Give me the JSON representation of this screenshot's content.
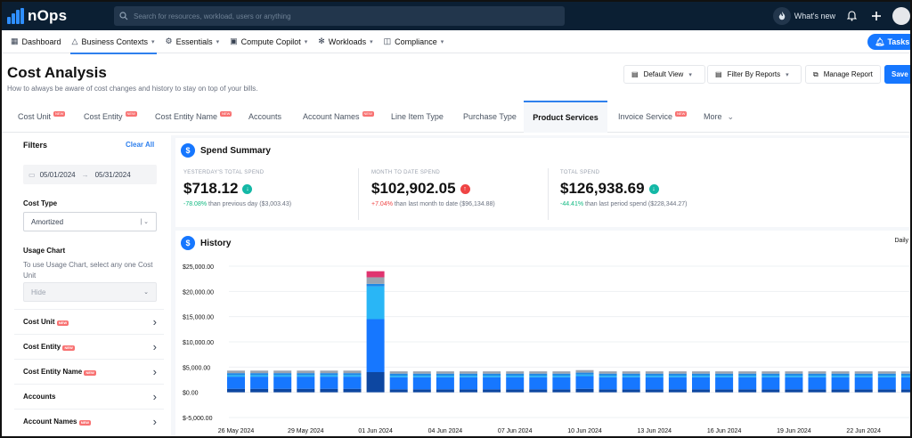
{
  "app": {
    "logo_text": "nOps"
  },
  "search": {
    "placeholder": "Search for resources, workload, users or anything"
  },
  "topbar": {
    "whats_new": "What's new"
  },
  "nav": {
    "items": [
      {
        "label": "Dashboard",
        "icon": "grid-icon"
      },
      {
        "label": "Business Contexts",
        "icon": "triangle-icon"
      },
      {
        "label": "Essentials",
        "icon": "gear-icon"
      },
      {
        "label": "Compute Copilot",
        "icon": "chip-icon"
      },
      {
        "label": "Workloads",
        "icon": "cog-icon"
      },
      {
        "label": "Compliance",
        "icon": "shield-icon"
      }
    ],
    "tasks_label": "Tasks"
  },
  "header": {
    "title": "Cost Analysis",
    "subtitle": "How to always be aware of cost changes and history to stay on top of your bills.",
    "default_view": "Default View",
    "filter_reports": "Filter By Reports",
    "manage_report": "Manage Report",
    "save": "Save I"
  },
  "tabs": [
    {
      "label": "Cost Unit",
      "badge": "NEW"
    },
    {
      "label": "Cost Entity",
      "badge": "NEW"
    },
    {
      "label": "Cost Entity Name",
      "badge": "NEW"
    },
    {
      "label": "Accounts",
      "badge": ""
    },
    {
      "label": "Account Names",
      "badge": "NEW"
    },
    {
      "label": "Line Item Type",
      "badge": ""
    },
    {
      "label": "Purchase Type",
      "badge": ""
    },
    {
      "label": "Product Services",
      "badge": "",
      "active": true
    },
    {
      "label": "Invoice Service",
      "badge": "NEW"
    },
    {
      "label": "More",
      "badge": ""
    }
  ],
  "sidebar": {
    "filters": "Filters",
    "clear_all": "Clear All",
    "date_start": "05/01/2024",
    "date_sep": "→",
    "date_end": "05/31/2024",
    "cost_type_label": "Cost Type",
    "cost_type_value": "Amortized",
    "usage_chart_label": "Usage Chart",
    "usage_chart_help": "To use Usage Chart, select any one Cost Unit",
    "usage_chart_value": "Hide",
    "rows": [
      {
        "label": "Cost Unit",
        "badge": "NEW"
      },
      {
        "label": "Cost Entity",
        "badge": "NEW"
      },
      {
        "label": "Cost Entity Name",
        "badge": "NEW"
      },
      {
        "label": "Accounts",
        "badge": ""
      },
      {
        "label": "Account Names",
        "badge": "NEW"
      }
    ]
  },
  "summary": {
    "title": "Spend Summary",
    "stats": [
      {
        "label": "YESTERDAY'S TOTAL SPEND",
        "value": "$718.12",
        "trend": "down",
        "pct": "-78.08%",
        "detail": "than previous day ($3,003.43)"
      },
      {
        "label": "MONTH TO DATE SPEND",
        "value": "$102,902.05",
        "trend": "up",
        "pct": "+7.04%",
        "detail": "than last month to date ($96,134.88)"
      },
      {
        "label": "TOTAL SPEND",
        "value": "$126,938.69",
        "trend": "down",
        "pct": "-44.41%",
        "detail": "than last period spend ($228,344.27)"
      }
    ]
  },
  "history": {
    "title": "History",
    "granularity": "Daily"
  },
  "colors": {
    "accent": "#1677ff",
    "seg_base": "#1677ff",
    "seg_mid": "#1e88e5",
    "seg_light": "#29b6f6",
    "seg_gray": "#9ca3af",
    "seg_pink": "#e0336f",
    "seg_dark": "#0d47a1"
  },
  "chart_data": {
    "type": "bar",
    "stacked": true,
    "title": "",
    "xlabel": "",
    "ylabel": "",
    "ylim": [
      -5000,
      25000
    ],
    "yticks": [
      -5000,
      0,
      5000,
      10000,
      15000,
      20000,
      25000
    ],
    "ytick_labels": [
      "$-5,000.00",
      "$0.00",
      "$5,000.00",
      "$10,000.00",
      "$15,000.00",
      "$20,000.00",
      "$25,000.00"
    ],
    "categories": [
      "26 May 2024",
      "27 May 2024",
      "28 May 2024",
      "29 May 2024",
      "30 May 2024",
      "31 May 2024",
      "01 Jun 2024",
      "02 Jun 2024",
      "03 Jun 2024",
      "04 Jun 2024",
      "05 Jun 2024",
      "06 Jun 2024",
      "07 Jun 2024",
      "08 Jun 2024",
      "09 Jun 2024",
      "10 Jun 2024",
      "11 Jun 2024",
      "12 Jun 2024",
      "13 Jun 2024",
      "14 Jun 2024",
      "15 Jun 2024",
      "16 Jun 2024",
      "17 Jun 2024",
      "18 Jun 2024",
      "19 Jun 2024",
      "20 Jun 2024",
      "21 Jun 2024",
      "22 Jun 2024",
      "23 Jun 2024",
      "24 Jun 2024",
      "25 Jun 2024"
    ],
    "xtick_labels": [
      "26 May 2024",
      "29 May 2024",
      "01 Jun 2024",
      "04 Jun 2024",
      "07 Jun 2024",
      "10 Jun 2024",
      "13 Jun 2024",
      "16 Jun 2024",
      "19 Jun 2024",
      "22 Jun 2024"
    ],
    "series": [
      {
        "values": [
          700,
          700,
          700,
          700,
          700,
          700,
          4000,
          600,
          600,
          600,
          600,
          600,
          600,
          600,
          600,
          700,
          600,
          600,
          600,
          600,
          600,
          600,
          600,
          600,
          600,
          600,
          600,
          600,
          600,
          600,
          0
        ]
      },
      {
        "values": [
          2400,
          2400,
          2400,
          2400,
          2400,
          2400,
          10500,
          2400,
          2400,
          2400,
          2400,
          2400,
          2400,
          2400,
          2400,
          2500,
          2400,
          2400,
          2400,
          2400,
          2400,
          2400,
          2400,
          2400,
          2400,
          2400,
          2400,
          2400,
          2400,
          2400,
          200
        ]
      },
      {
        "values": [
          300,
          300,
          300,
          300,
          300,
          300,
          6500,
          300,
          300,
          300,
          300,
          300,
          300,
          300,
          300,
          300,
          300,
          300,
          300,
          300,
          300,
          300,
          300,
          300,
          300,
          300,
          300,
          300,
          300,
          300,
          0
        ]
      },
      {
        "values": [
          400,
          400,
          400,
          400,
          400,
          400,
          500,
          400,
          400,
          400,
          400,
          400,
          400,
          400,
          400,
          400,
          400,
          400,
          400,
          400,
          400,
          400,
          400,
          400,
          400,
          400,
          400,
          400,
          400,
          400,
          0
        ]
      },
      {
        "values": [
          500,
          500,
          500,
          500,
          500,
          500,
          1300,
          450,
          450,
          450,
          450,
          450,
          450,
          450,
          450,
          500,
          450,
          450,
          450,
          450,
          450,
          450,
          450,
          450,
          450,
          450,
          450,
          450,
          450,
          450,
          0
        ]
      },
      {
        "values": [
          0,
          0,
          0,
          0,
          0,
          0,
          1200,
          0,
          0,
          0,
          0,
          0,
          0,
          0,
          0,
          0,
          0,
          0,
          0,
          0,
          0,
          0,
          0,
          0,
          0,
          0,
          0,
          0,
          0,
          0,
          0
        ]
      }
    ]
  }
}
